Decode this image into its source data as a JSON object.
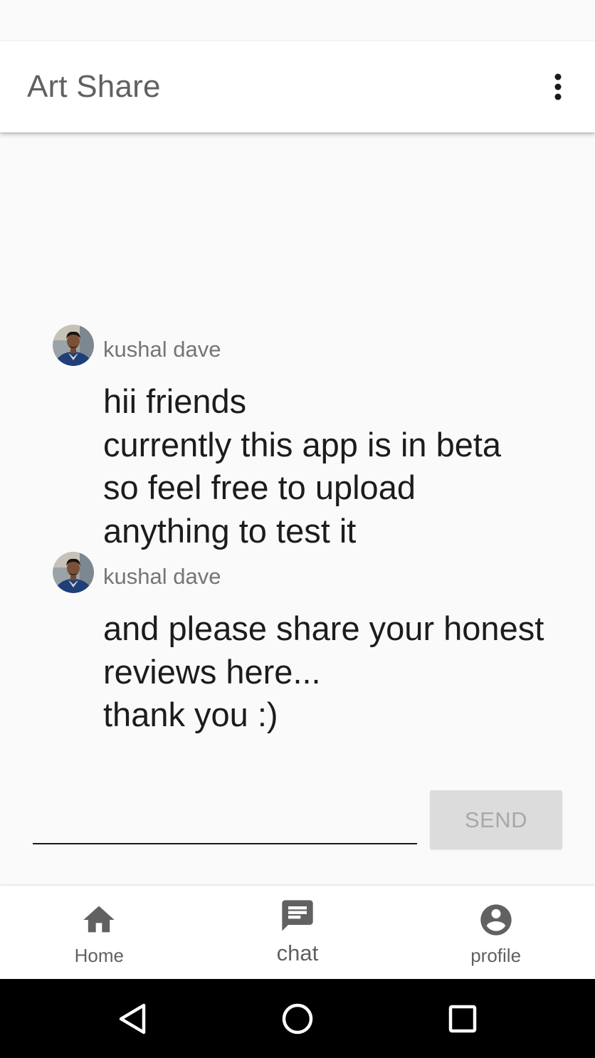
{
  "app_bar": {
    "title": "Art Share",
    "overflow_icon": "more-vert-icon"
  },
  "messages": [
    {
      "author": "kushal dave",
      "text": "hii friends\ncurrently this app is in beta so feel free to upload anything to test it",
      "avatar_icon": "user-avatar"
    },
    {
      "author": "kushal dave",
      "text": "and please share your honest reviews here...\nthank you :)",
      "avatar_icon": "user-avatar"
    }
  ],
  "composer": {
    "value": "",
    "placeholder": "",
    "send_label": "SEND"
  },
  "bottom_nav": {
    "items": [
      {
        "label": "Home",
        "icon": "home-icon",
        "active": false
      },
      {
        "label": "chat",
        "icon": "chat-icon",
        "active": true
      },
      {
        "label": "profile",
        "icon": "account-circle-icon",
        "active": false
      }
    ]
  },
  "system_nav": {
    "back_icon": "back-triangle-icon",
    "home_icon": "home-circle-icon",
    "recents_icon": "recents-square-icon"
  },
  "colors": {
    "background": "#fafafa",
    "app_bar": "#ffffff",
    "title_text": "#616161",
    "author_text": "#757575",
    "message_text": "#1c1c1c",
    "send_disabled_bg": "#dcdcdc",
    "send_disabled_text": "#a8a8a8",
    "nav_icon": "#616161",
    "system_nav_bg": "#000000"
  }
}
